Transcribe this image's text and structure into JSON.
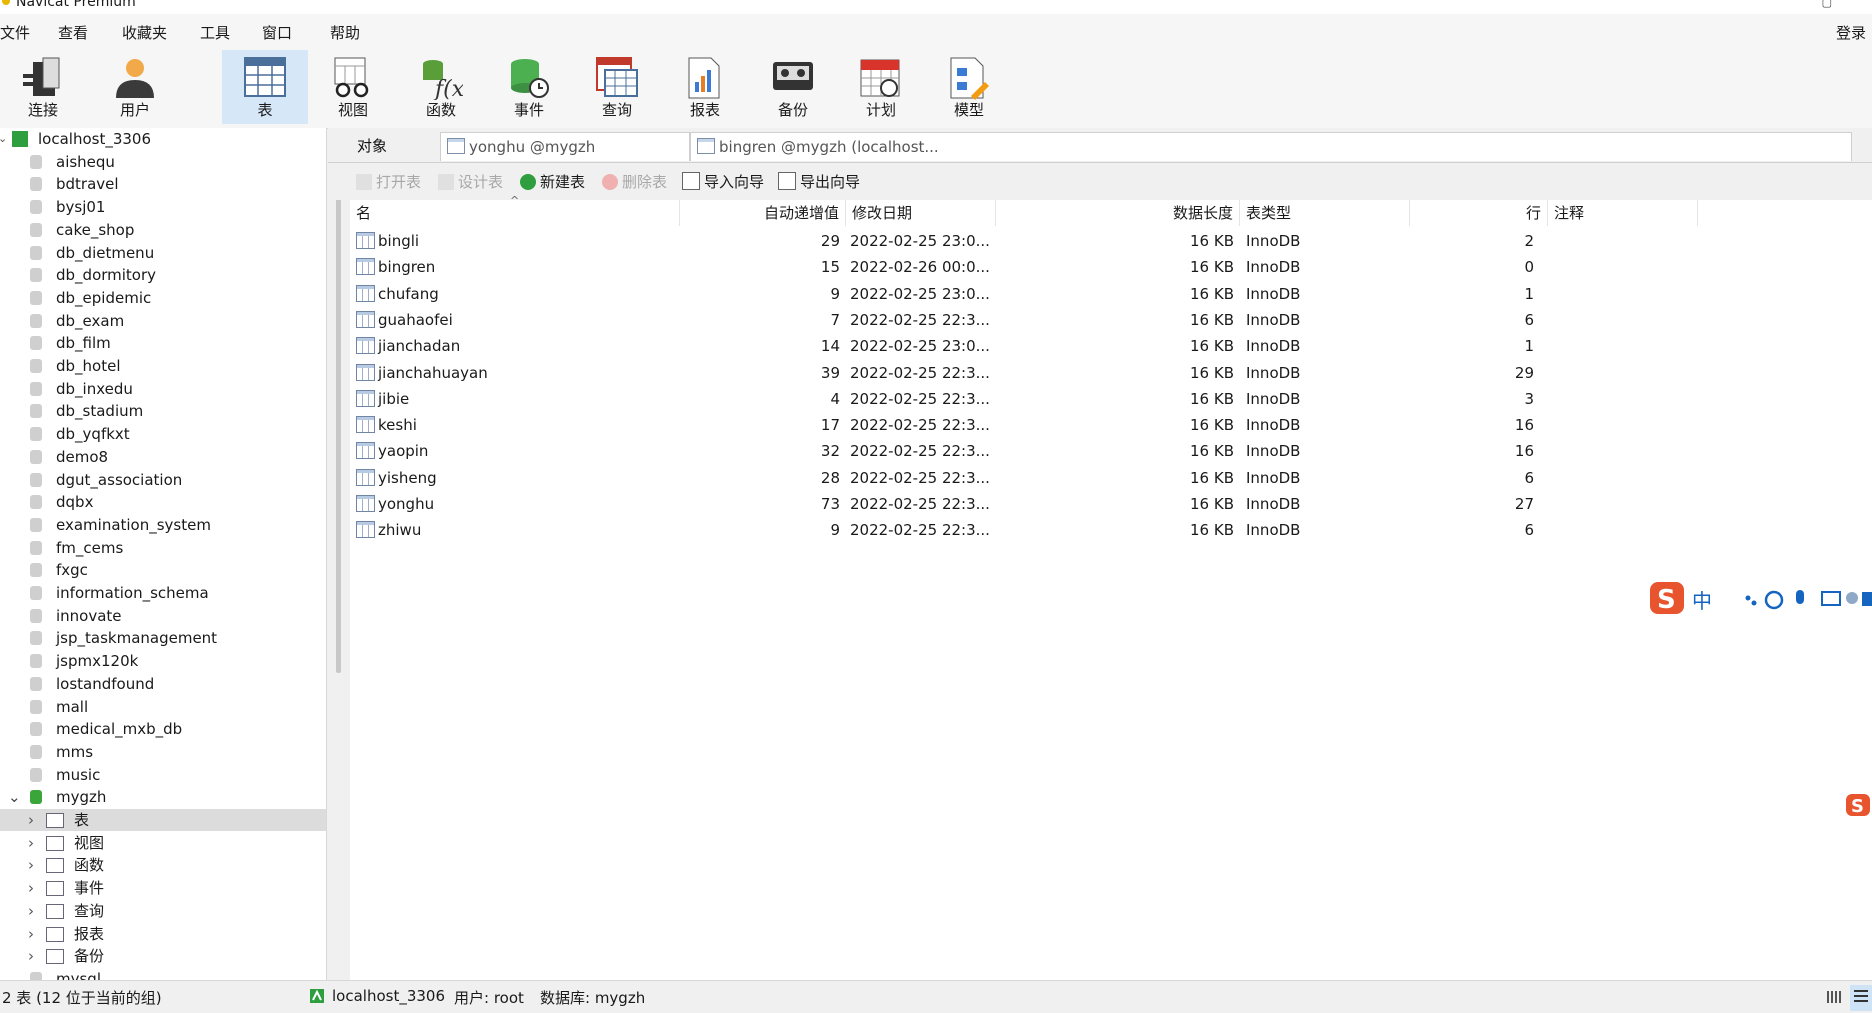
{
  "window": {
    "title": "Navicat Premium"
  },
  "menu": {
    "items": [
      "文件",
      "查看",
      "收藏夹",
      "工具",
      "窗口",
      "帮助"
    ],
    "login": "登录"
  },
  "toolbar": {
    "buttons": [
      "连接",
      "用户",
      "表",
      "视图",
      "函数",
      "事件",
      "查询",
      "报表",
      "备份",
      "计划",
      "模型"
    ],
    "active": "表"
  },
  "sidebar": {
    "connection": "localhost_3306",
    "databases": [
      "aishequ",
      "bdtravel",
      "bysj01",
      "cake_shop",
      "db_dietmenu",
      "db_dormitory",
      "db_epidemic",
      "db_exam",
      "db_film",
      "db_hotel",
      "db_inxedu",
      "db_stadium",
      "db_yqfkxt",
      "demo8",
      "dgut_association",
      "dqbx",
      "examination_system",
      "fm_cems",
      "fxgc",
      "information_schema",
      "innovate",
      "jsp_taskmanagement",
      "jspmx120k",
      "lostandfound",
      "mall",
      "medical_mxb_db",
      "mms",
      "music",
      "mygzh"
    ],
    "expanded_db": "mygzh",
    "children": [
      "表",
      "视图",
      "函数",
      "事件",
      "查询",
      "报表",
      "备份"
    ],
    "next_db": "mysql"
  },
  "tabs": {
    "objects": "对象",
    "tab1": "yonghu @mygzh (localhost_...",
    "tab2": "bingren @mygzh (localhost..."
  },
  "actions": {
    "open": "打开表",
    "design": "设计表",
    "new": "新建表",
    "delete": "删除表",
    "import": "导入向导",
    "export": "导出向导"
  },
  "table": {
    "columns": [
      "名",
      "自动递增值",
      "修改日期",
      "数据长度",
      "表类型",
      "行",
      "注释"
    ],
    "rows": [
      {
        "name": "bingli",
        "auto": "29",
        "date": "2022-02-25 23:0...",
        "size": "16 KB",
        "engine": "InnoDB",
        "rows": "2"
      },
      {
        "name": "bingren",
        "auto": "15",
        "date": "2022-02-26 00:0...",
        "size": "16 KB",
        "engine": "InnoDB",
        "rows": "0"
      },
      {
        "name": "chufang",
        "auto": "9",
        "date": "2022-02-25 23:0...",
        "size": "16 KB",
        "engine": "InnoDB",
        "rows": "1"
      },
      {
        "name": "guahaofei",
        "auto": "7",
        "date": "2022-02-25 22:3...",
        "size": "16 KB",
        "engine": "InnoDB",
        "rows": "6"
      },
      {
        "name": "jianchadan",
        "auto": "14",
        "date": "2022-02-25 23:0...",
        "size": "16 KB",
        "engine": "InnoDB",
        "rows": "1"
      },
      {
        "name": "jianchahuayan",
        "auto": "39",
        "date": "2022-02-25 22:3...",
        "size": "16 KB",
        "engine": "InnoDB",
        "rows": "29"
      },
      {
        "name": "jibie",
        "auto": "4",
        "date": "2022-02-25 22:3...",
        "size": "16 KB",
        "engine": "InnoDB",
        "rows": "3"
      },
      {
        "name": "keshi",
        "auto": "17",
        "date": "2022-02-25 22:3...",
        "size": "16 KB",
        "engine": "InnoDB",
        "rows": "16"
      },
      {
        "name": "yaopin",
        "auto": "32",
        "date": "2022-02-25 22:3...",
        "size": "16 KB",
        "engine": "InnoDB",
        "rows": "16"
      },
      {
        "name": "yisheng",
        "auto": "28",
        "date": "2022-02-25 22:3...",
        "size": "16 KB",
        "engine": "InnoDB",
        "rows": "6"
      },
      {
        "name": "yonghu",
        "auto": "73",
        "date": "2022-02-25 22:3...",
        "size": "16 KB",
        "engine": "InnoDB",
        "rows": "27"
      },
      {
        "name": "zhiwu",
        "auto": "9",
        "date": "2022-02-25 22:3...",
        "size": "16 KB",
        "engine": "InnoDB",
        "rows": "6"
      }
    ]
  },
  "status": {
    "left": "2 表 (12 位于当前的组)",
    "connection": "localhost_3306",
    "user": "用户: root",
    "database": "数据库: mygzh"
  },
  "ime": {
    "lang": "中"
  },
  "colors": {
    "accent": "#d6e8f8",
    "green": "#2e9e3e",
    "select": "#dcdcdc"
  }
}
